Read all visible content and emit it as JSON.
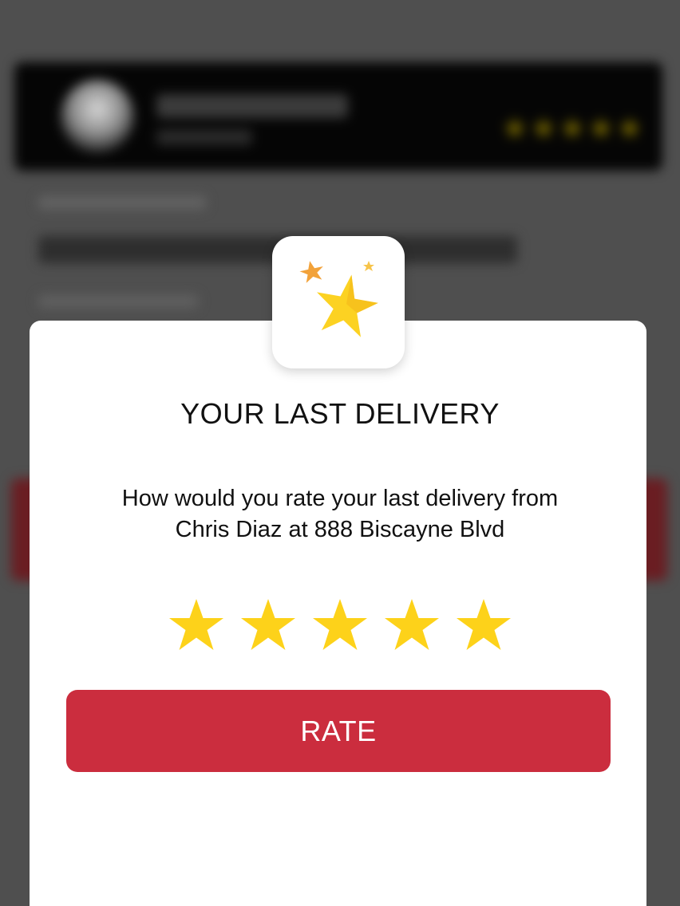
{
  "modal": {
    "title": "YOUR LAST DELIVERY",
    "message_line1": "How would you rate your last delivery from",
    "message_line2": "Chris Diaz at 888 Biscayne Blvd",
    "rating_max": 5,
    "rating_value": 5,
    "rate_button_label": "RATE",
    "badge_icon": "stars-icon"
  },
  "colors": {
    "accent_red": "#cb2d3e",
    "star_yellow": "#fdd21a",
    "overlay_gray": "#4f4f4f"
  }
}
